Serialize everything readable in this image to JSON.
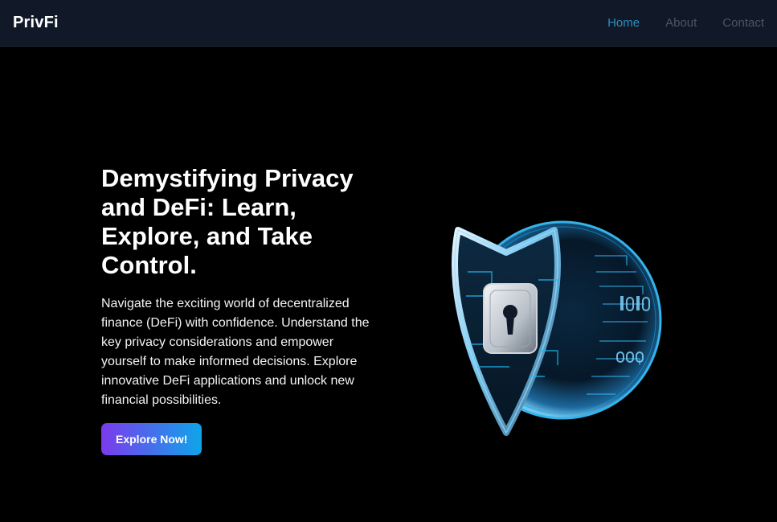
{
  "nav": {
    "brand": "PrivFi",
    "links": [
      {
        "label": "Home",
        "active": true
      },
      {
        "label": "About",
        "active": false
      },
      {
        "label": "Contact",
        "active": false
      }
    ]
  },
  "hero": {
    "title": "Demystifying Privacy and DeFi: Learn, Explore, and Take Control.",
    "description": "Navigate the exciting world of decentralized finance (DeFi) with confidence. Understand the key privacy considerations and empower yourself to make informed decisions. Explore innovative DeFi applications and unlock new financial possibilities.",
    "cta_label": "Explore Now!",
    "image_icon": "shield-lock-icon"
  },
  "colors": {
    "nav_bg": "#111827",
    "page_bg": "#000000",
    "active_link": "#2a8fc0",
    "inactive_link": "#4b5563",
    "cta_gradient_start": "#7c3aed",
    "cta_gradient_end": "#0ea5e9",
    "shield_glow": "#38bdf8"
  }
}
